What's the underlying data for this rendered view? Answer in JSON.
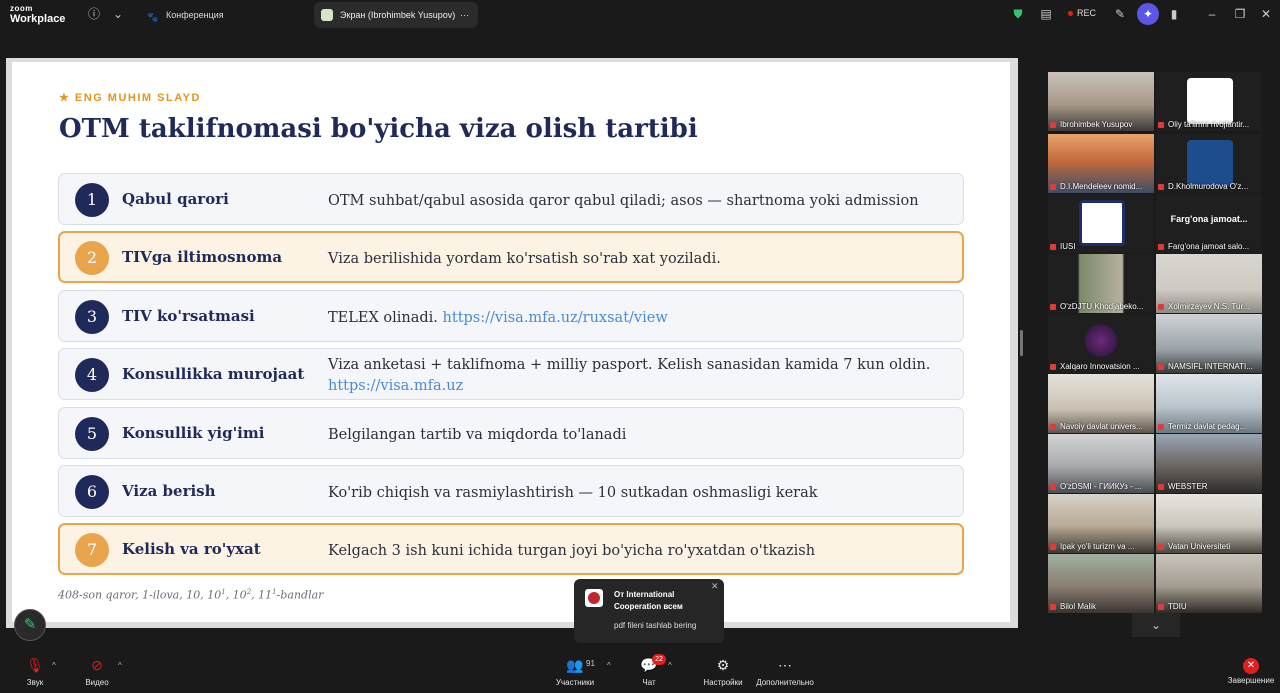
{
  "app": {
    "logo_line1": "zoom",
    "logo_line2": "Workplace"
  },
  "tabs": {
    "meeting": "Конференция",
    "share": "Экран (Ibrohimbek Yusupov)"
  },
  "status": {
    "rec": "REC"
  },
  "slide": {
    "kicker": "★ ENG MUHIM SLAYD",
    "title": "OTM taklifnomasi bo'yicha viza olish tartibi",
    "steps": [
      {
        "num": "1",
        "label": "Qabul qarori",
        "desc": "OTM suhbat/qabul asosida qaror qabul qiladi; asos — shartnoma yoki admission",
        "link": ""
      },
      {
        "num": "2",
        "label": "TIVga iltimosnoma",
        "desc": "Viza berilishida yordam ko'rsatish so'rab xat yoziladi.",
        "link": ""
      },
      {
        "num": "3",
        "label": "TIV ko'rsatmasi",
        "desc": "TELEX olinadi.",
        "link": "https://visa.mfa.uz/ruxsat/view"
      },
      {
        "num": "4",
        "label": "Konsullikka murojaat",
        "desc": "Viza anketasi + taklifnoma + milliy pasport. Kelish sanasidan kamida 7 kun oldin.",
        "link": "https://visa.mfa.uz"
      },
      {
        "num": "5",
        "label": "Konsullik yig'imi",
        "desc": "Belgilangan tartib va miqdorda to'lanadi",
        "link": ""
      },
      {
        "num": "6",
        "label": "Viza berish",
        "desc": "Ko'rib chiqish va rasmiylashtirish — 10 sutkadan oshmasligi kerak",
        "link": ""
      },
      {
        "num": "7",
        "label": "Kelish va ro'yxat",
        "desc": "Kelgach 3 ish kuni ichida turgan joyi bo'yicha ro'yxatdan o'tkazish",
        "link": ""
      }
    ],
    "footnote": {
      "main": "408-son qaror, 1-ilova, 10, 10",
      "s1": "1",
      "mid": ", 10",
      "s2": "2",
      "mid2": ", 11",
      "s3": "1",
      "end": "-bandlar"
    }
  },
  "participants": [
    "Ibrohimbek Yusupov",
    "Oliy ta'limni rivojlantir...",
    "D.I.Mendeleev nomid...",
    "D.Kholmurodova O'z...",
    "IUSI",
    "Farg'ona jamoat salo...",
    "O'zDJTU Khodjabeko...",
    "Xolmirzayev N.S. Tur...",
    "Xalqaro Innovatsion ...",
    "NAMSIFL INTERNATI...",
    "Navoiy davlat univers...",
    "Termiz davlat pedag...",
    "O'zDSMI - ГИИКУз - ...",
    "WEBSTER",
    "Ipak yo'li turizm va ...",
    "Vatan Universiteti",
    "Bilol Malik",
    "TDIU"
  ],
  "participant_bigname": "Farg'ona  jamoat...",
  "notification": {
    "title": "От International Cooperation всем",
    "body": "pdf fileni tashlab bering"
  },
  "toolbar": {
    "audio": "Звук",
    "video": "Видео",
    "participants": "Участники",
    "participants_count": "91",
    "chat": "Чат",
    "chat_badge": "22",
    "settings": "Настройки",
    "more": "Дополнительно",
    "end": "Завершение"
  },
  "colors": {
    "navy": "#1f2a5a",
    "accent": "#e8a54c",
    "link": "#4a8ad6"
  }
}
